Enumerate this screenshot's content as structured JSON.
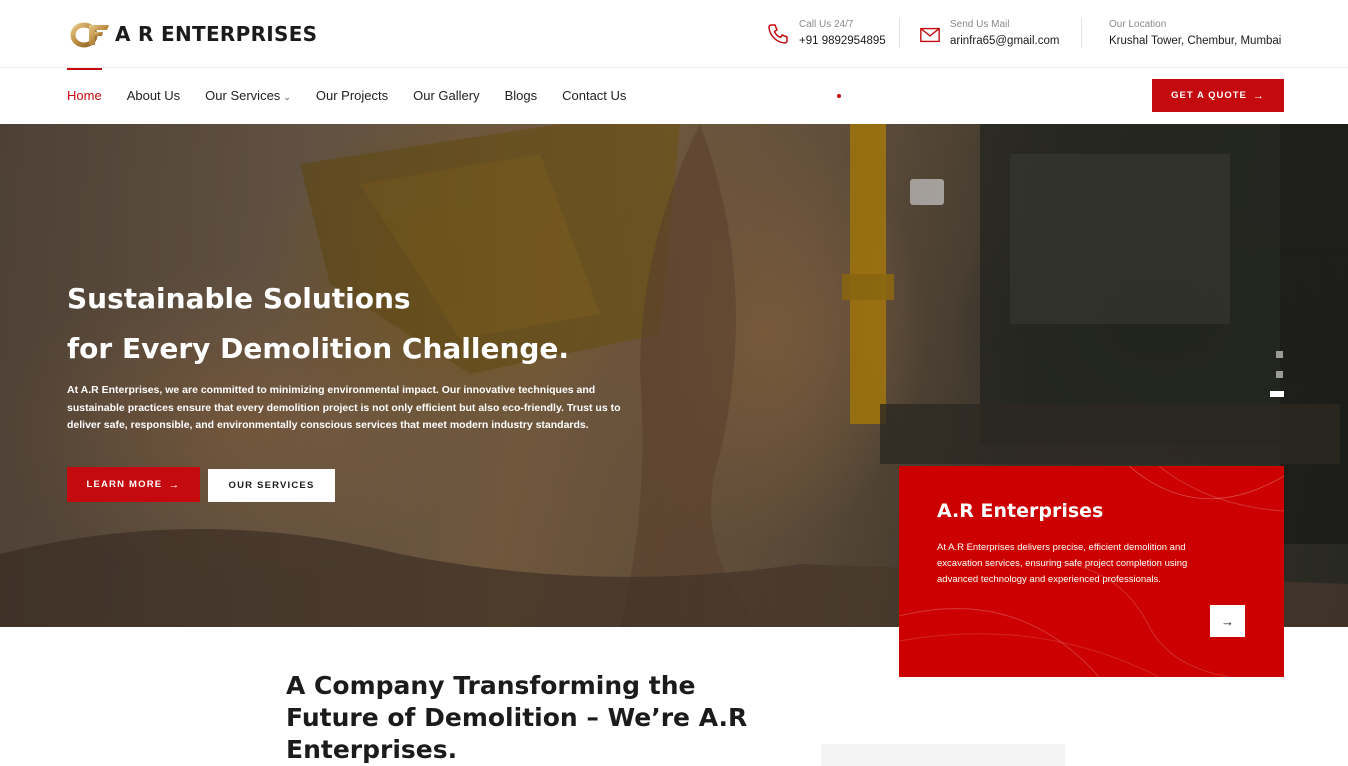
{
  "header": {
    "logo_text": "A R ENTERPRISES",
    "contacts": [
      {
        "icon": "phone-icon",
        "label": "Call Us 24/7",
        "value": "+91 9892954895"
      },
      {
        "icon": "mail-icon",
        "label": "Send Us Mail",
        "value": "arinfra65@gmail.com"
      },
      {
        "icon": "none",
        "label": "Our Location",
        "value": "Krushal Tower, Chembur, Mumbai"
      }
    ]
  },
  "nav": {
    "items": [
      {
        "label": "Home",
        "active": true
      },
      {
        "label": "About Us"
      },
      {
        "label": "Our Services",
        "dropdown": true
      },
      {
        "label": "Our Projects"
      },
      {
        "label": "Our Gallery"
      },
      {
        "label": "Blogs"
      },
      {
        "label": "Contact Us"
      }
    ],
    "caret": "⌄",
    "cta_label": "GET A QUOTE",
    "arrow": "→"
  },
  "hero": {
    "title_line1": "Sustainable Solutions",
    "title_line2": "for Every Demolition Challenge.",
    "text": "At A.R Enterprises, we are committed to minimizing environmental impact. Our innovative techniques and sustainable practices ensure that every demolition project is not only efficient but also eco-friendly. Trust us to deliver safe, responsible, and environmentally conscious services that meet modern industry standards.",
    "learn_more_label": "LEARN MORE",
    "services_label": "OUR SERVICES",
    "slides_total": 3,
    "active_slide": 3
  },
  "card": {
    "title": "A.R Enterprises",
    "text": "At A.R Enterprises delivers precise, efficient demolition and excavation services, ensuring safe project completion using advanced technology and experienced professionals.",
    "arrow": "→"
  },
  "about": {
    "title": "A Company Transforming the Future of Demolition – We’re A.R Enterprises."
  },
  "colors": {
    "accent": "#c4090f",
    "card": "#cc0000",
    "text": "#1b1b1b"
  }
}
